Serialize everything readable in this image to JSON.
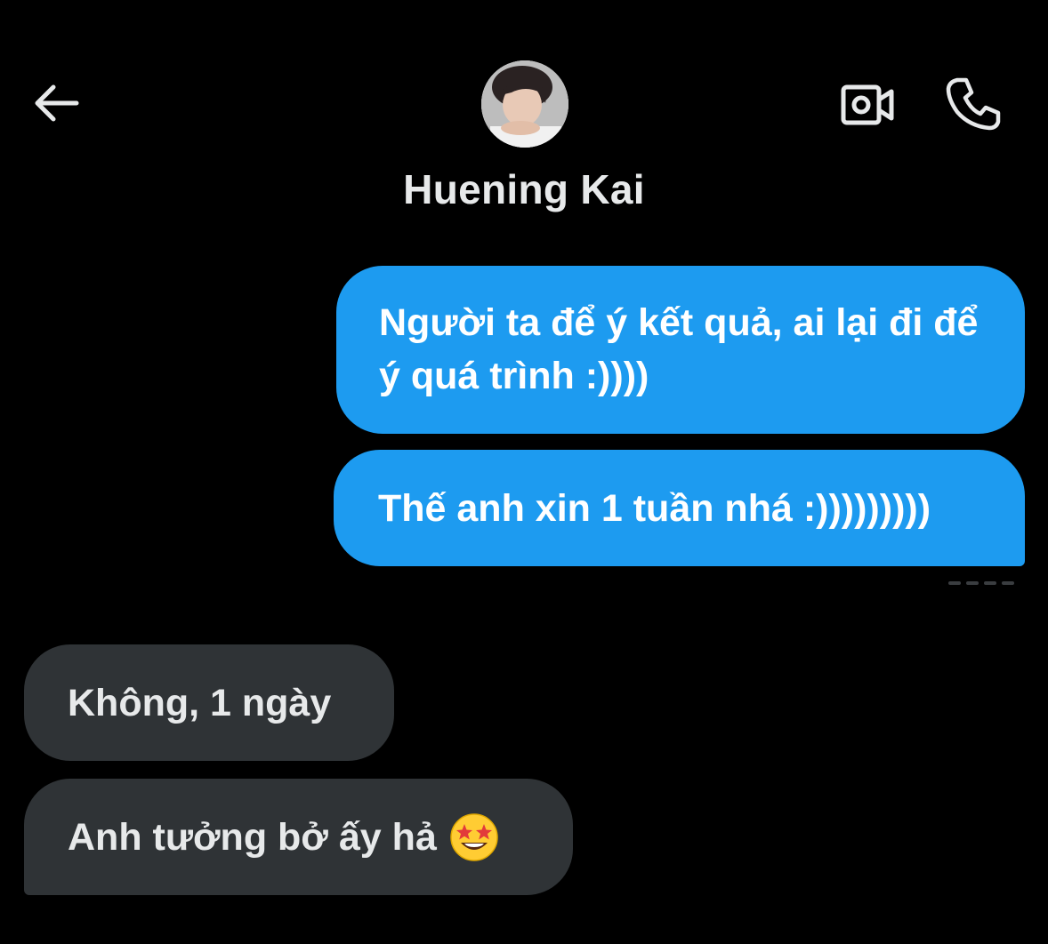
{
  "header": {
    "contact_name": "Huening Kai",
    "back_icon": "arrow-left-icon",
    "video_icon": "video-camera-icon",
    "call_icon": "phone-icon"
  },
  "messages": [
    {
      "direction": "outgoing",
      "text": "Người ta để ý kết quả, ai lại đi để ý quá trình :))))"
    },
    {
      "direction": "outgoing",
      "text": "Thế anh xin 1 tuần nhá :)))))))))"
    },
    {
      "direction": "incoming",
      "text": "Không, 1 ngày"
    },
    {
      "direction": "incoming",
      "text": "Anh tưởng bở ấy hả",
      "emoji": "star-struck-emoji"
    }
  ],
  "colors": {
    "background": "#000000",
    "outgoing_bubble": "#1d9bf0",
    "incoming_bubble": "#2f3336",
    "text": "#e7e9ea"
  }
}
